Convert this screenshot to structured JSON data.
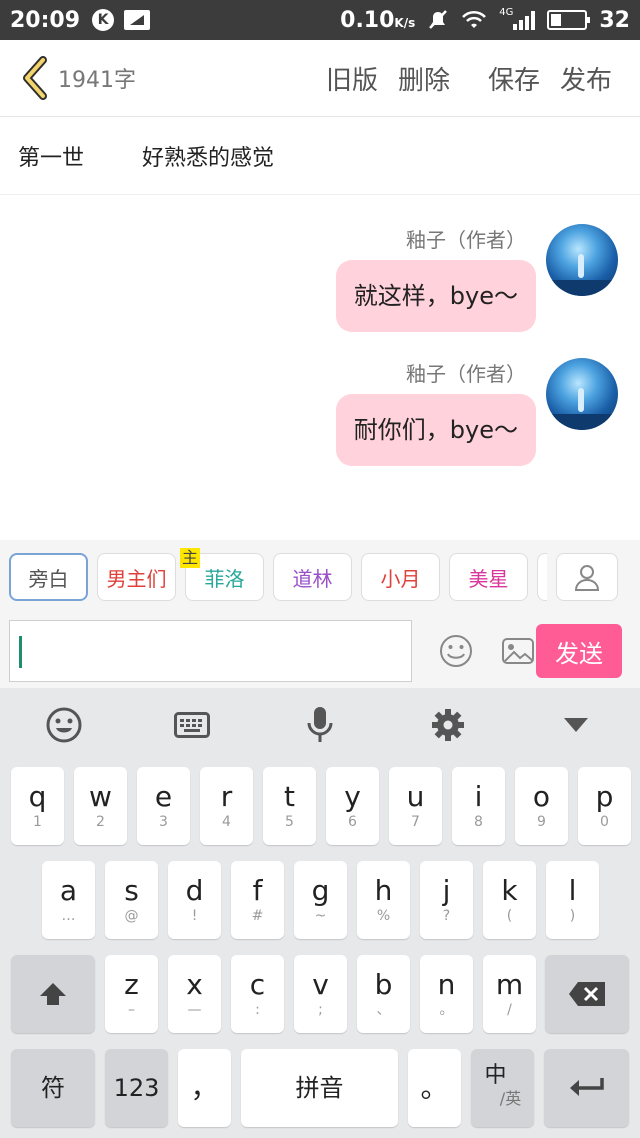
{
  "status_bar": {
    "time": "20:09",
    "k_icon": "K",
    "speed": "0.10",
    "speed_unit": "K/s",
    "network": "4G",
    "battery": "32"
  },
  "header": {
    "word_count": "1941字",
    "old_version": "旧版",
    "delete": "删除",
    "save": "保存",
    "publish": "发布"
  },
  "chapter": {
    "number": "第一世",
    "title": "好熟悉的感觉"
  },
  "messages": [
    {
      "author": "釉子（作者）",
      "text": "就这样，bye～"
    },
    {
      "author": "釉子（作者）",
      "text": "耐你们，bye～"
    }
  ],
  "roles": [
    {
      "label": "旁白",
      "color": "#555555",
      "selected": true
    },
    {
      "label": "男主们",
      "color": "#e0403a",
      "selected": false
    },
    {
      "label": "菲洛",
      "color": "#28a89a",
      "selected": false,
      "badge": "主"
    },
    {
      "label": "道林",
      "color": "#9a4fc9",
      "selected": false
    },
    {
      "label": "小月",
      "color": "#e0403a",
      "selected": false
    },
    {
      "label": "美星",
      "color": "#d9369b",
      "selected": false
    }
  ],
  "input": {
    "value": "",
    "send_label": "发送"
  },
  "keyboard": {
    "row1": [
      [
        "q",
        "1"
      ],
      [
        "w",
        "2"
      ],
      [
        "e",
        "3"
      ],
      [
        "r",
        "4"
      ],
      [
        "t",
        "5"
      ],
      [
        "y",
        "6"
      ],
      [
        "u",
        "7"
      ],
      [
        "i",
        "8"
      ],
      [
        "o",
        "9"
      ],
      [
        "p",
        "0"
      ]
    ],
    "row2": [
      [
        "a",
        "…"
      ],
      [
        "s",
        "@"
      ],
      [
        "d",
        "!"
      ],
      [
        "f",
        "#"
      ],
      [
        "g",
        "~"
      ],
      [
        "h",
        "%"
      ],
      [
        "j",
        "?"
      ],
      [
        "k",
        "("
      ],
      [
        "l",
        ")"
      ]
    ],
    "row3": [
      [
        "z",
        "–"
      ],
      [
        "x",
        "—"
      ],
      [
        "c",
        ":"
      ],
      [
        "v",
        ";"
      ],
      [
        "b",
        "、"
      ],
      [
        "n",
        "。"
      ],
      [
        "m",
        "/"
      ]
    ],
    "symbols": "符",
    "numbers": "123",
    "comma": "，",
    "space": "拼音",
    "period": "。",
    "lang_main": "中",
    "lang_sub": "/英"
  }
}
